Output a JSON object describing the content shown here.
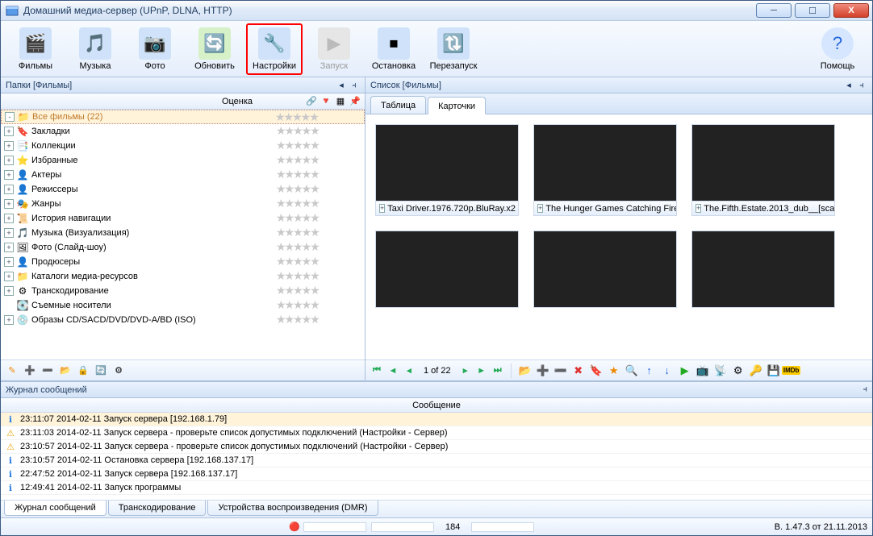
{
  "window": {
    "title": "Домашний медиа-сервер (UPnP, DLNA, HTTP)"
  },
  "toolbar": {
    "films": "Фильмы",
    "music": "Музыка",
    "photo": "Фото",
    "refresh": "Обновить",
    "settings": "Настройки",
    "start": "Запуск",
    "stop": "Остановка",
    "restart": "Перезапуск",
    "help": "Помощь"
  },
  "left_panel": {
    "header": "Папки [Фильмы]",
    "col_rating": "Оценка",
    "tree": [
      {
        "label": "Все фильмы (22)",
        "icon": "📁",
        "selected": true,
        "exp": "-"
      },
      {
        "label": "Закладки",
        "icon": "🔖",
        "exp": "+"
      },
      {
        "label": "Коллекции",
        "icon": "📑",
        "exp": "+"
      },
      {
        "label": "Избранные",
        "icon": "⭐",
        "exp": "+"
      },
      {
        "label": "Актеры",
        "icon": "👤",
        "exp": "+"
      },
      {
        "label": "Режиссеры",
        "icon": "👤",
        "exp": "+"
      },
      {
        "label": "Жанры",
        "icon": "🎭",
        "exp": "+"
      },
      {
        "label": "История навигации",
        "icon": "📜",
        "exp": "+"
      },
      {
        "label": "Музыка (Визуализация)",
        "icon": "🎵",
        "exp": "+"
      },
      {
        "label": "Фото (Слайд-шоу)",
        "icon": "🖼",
        "exp": "+"
      },
      {
        "label": "Продюсеры",
        "icon": "👤",
        "exp": "+"
      },
      {
        "label": "Каталоги медиа-ресурсов",
        "icon": "📁",
        "exp": "+"
      },
      {
        "label": "Транскодирование",
        "icon": "⚙",
        "exp": "+"
      },
      {
        "label": "Съемные носители",
        "icon": "💽",
        "exp": ""
      },
      {
        "label": "Образы CD/SACD/DVD/DVD-A/BD (ISO)",
        "icon": "💿",
        "exp": "+"
      }
    ]
  },
  "right_panel": {
    "header": "Список [Фильмы]",
    "tabs": {
      "table": "Таблица",
      "cards": "Карточки"
    },
    "cards": [
      {
        "title": "Taxi Driver.1976.720p.BluRay.x2"
      },
      {
        "title": "The Hunger Games Catching Fire."
      },
      {
        "title": "The.Fifth.Estate.2013_dub__[sca"
      },
      {
        "title": ""
      },
      {
        "title": ""
      },
      {
        "title": ""
      }
    ],
    "pager": "1 of 22"
  },
  "log_panel": {
    "header": "Журнал сообщений",
    "col": "Сообщение",
    "rows": [
      {
        "icon": "info",
        "text": "23:11:07 2014-02-11 Запуск сервера [192.168.1.79]"
      },
      {
        "icon": "warn",
        "text": "23:11:03 2014-02-11 Запуск сервера - проверьте список допустимых подключений (Настройки - Сервер)"
      },
      {
        "icon": "warn",
        "text": "23:10:57 2014-02-11 Запуск сервера - проверьте список допустимых подключений (Настройки - Сервер)"
      },
      {
        "icon": "info",
        "text": "23:10:57 2014-02-11 Остановка сервера [192.168.137.17]"
      },
      {
        "icon": "info",
        "text": "22:47:52 2014-02-11 Запуск сервера [192.168.137.17]"
      },
      {
        "icon": "info",
        "text": "12:49:41 2014-02-11 Запуск программы"
      }
    ],
    "tabs": {
      "log": "Журнал сообщений",
      "trans": "Транскодирование",
      "dmr": "Устройства воспроизведения (DMR)"
    }
  },
  "status": {
    "count": "184",
    "version": "В. 1.47.3 от 21.11.2013"
  }
}
